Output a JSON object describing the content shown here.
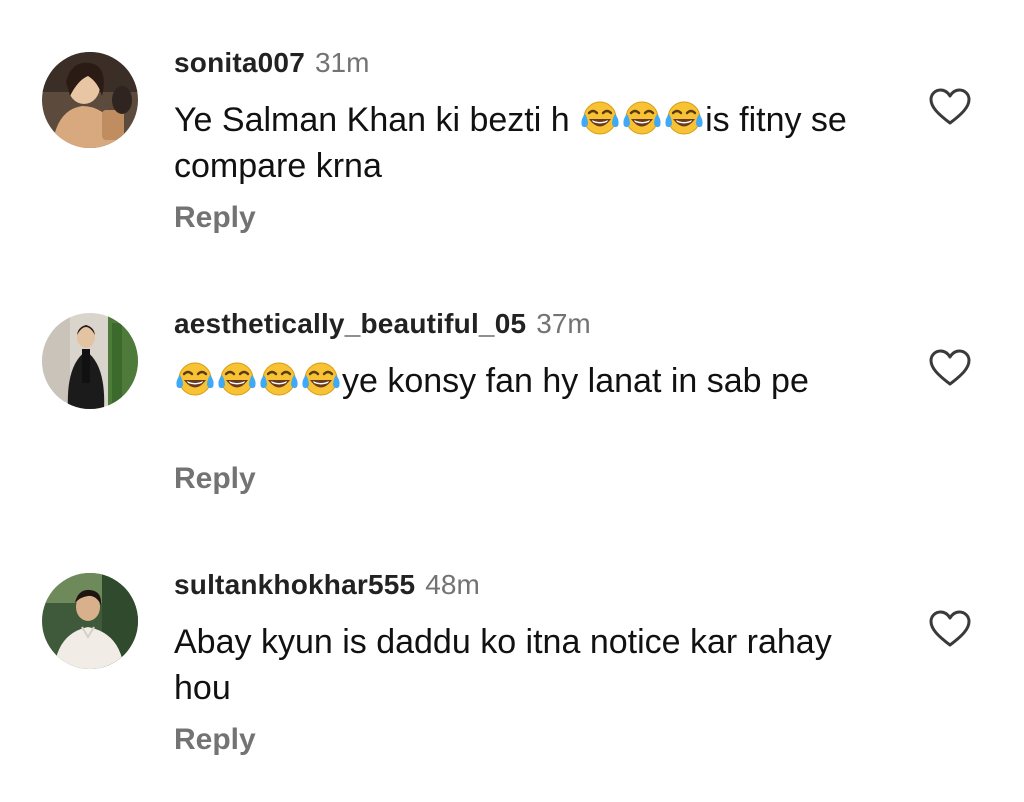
{
  "comments": [
    {
      "username": "sonita007",
      "time": "31m",
      "text_before": "Ye Salman Khan ki bezti h ",
      "emojis": [
        "joy-emoji",
        "joy-emoji",
        "joy-emoji"
      ],
      "text_after": "is fitny se compare krna",
      "reply_label": "Reply",
      "like_icon": "heart-outline-icon"
    },
    {
      "username": "aesthetically_beautiful_05",
      "time": "37m",
      "text_before": "",
      "emojis": [
        "joy-emoji",
        "joy-emoji",
        "joy-emoji",
        "joy-emoji"
      ],
      "text_after": "ye konsy fan hy lanat in sab pe",
      "reply_label": "Reply",
      "like_icon": "heart-outline-icon"
    },
    {
      "username": "sultankhokhar555",
      "time": "48m",
      "text_before": "Abay kyun is daddu ko itna notice kar rahay hou",
      "emojis": [],
      "text_after": "",
      "reply_label": "Reply",
      "like_icon": "heart-outline-icon"
    }
  ]
}
